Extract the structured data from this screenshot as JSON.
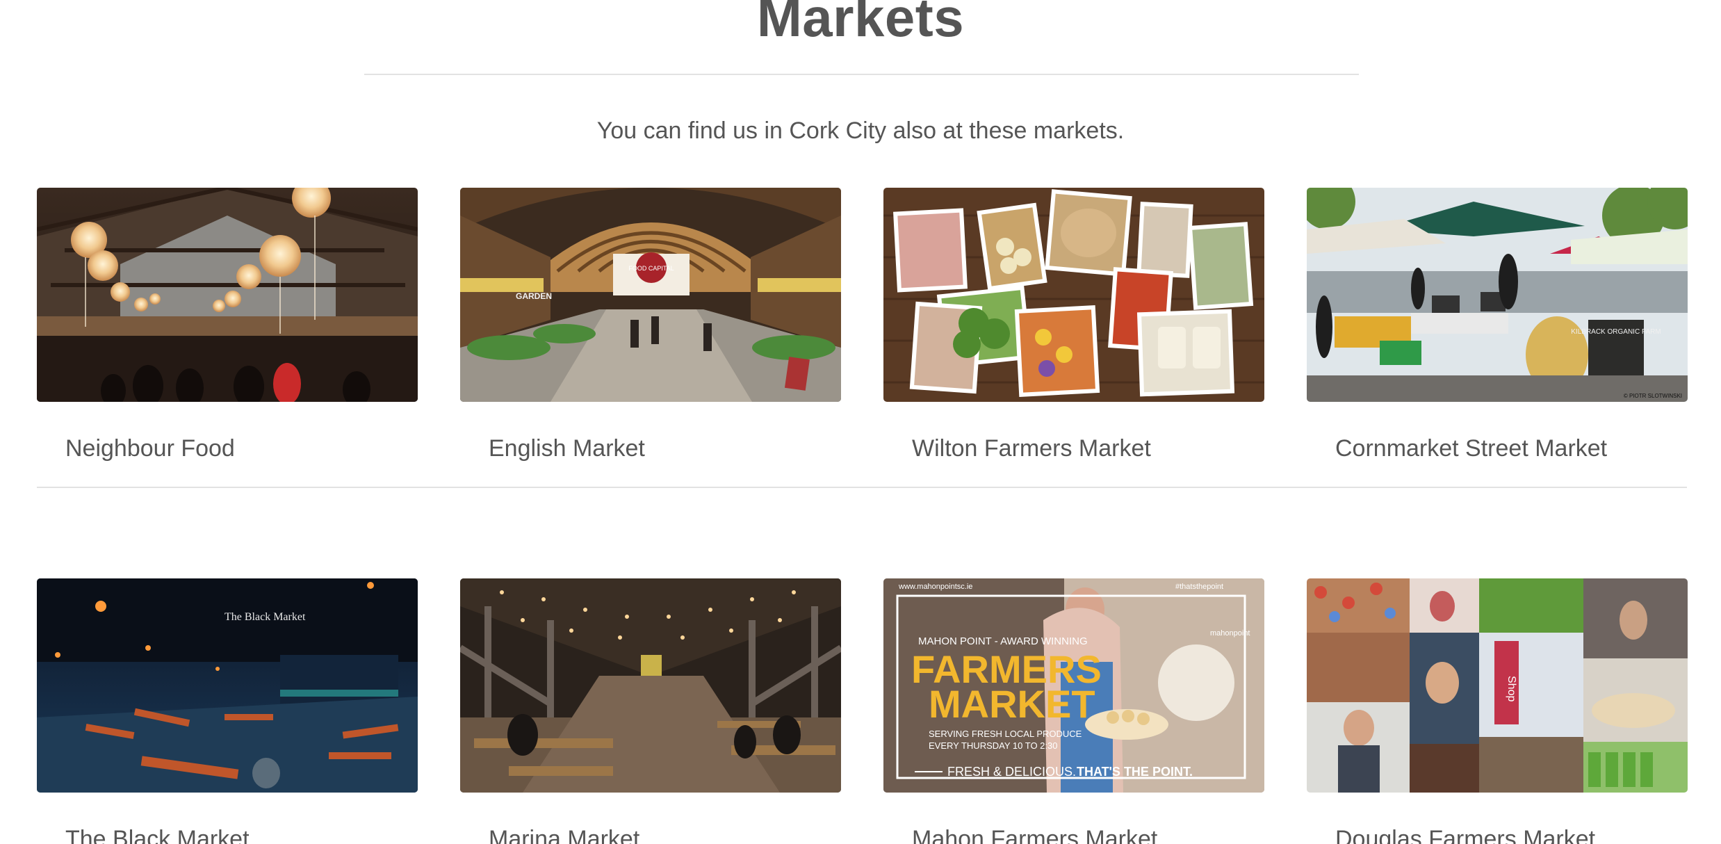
{
  "page": {
    "title": "Markets",
    "intro": "You can find us in Cork City also at these markets."
  },
  "markets": [
    {
      "name": "Neighbour Food",
      "image": "neighbour-food-hall-lanterns"
    },
    {
      "name": "English Market",
      "image": "english-market-hall"
    },
    {
      "name": "Wilton Farmers Market",
      "image": "wilton-produce-collage"
    },
    {
      "name": "Cornmarket Street Market",
      "image": "cornmarket-street-stalls"
    },
    {
      "name": "The Black Market",
      "image": "black-market-night-seating"
    },
    {
      "name": "Marina Market",
      "image": "marina-market-warehouse"
    },
    {
      "name": "Mahon Farmers Market",
      "image": "mahon-farmers-market-poster"
    },
    {
      "name": "Douglas Farmers Market",
      "image": "douglas-market-collage"
    }
  ],
  "image_text": {
    "english_market_sign": "FOOD CAPITAL",
    "english_market_stall": "GARDEN",
    "cornmarket_board": "KILBRACK ORGANIC FARM",
    "cornmarket_credit": "© PIOTR SLOTWINSKI",
    "black_market_sign": "The Black Market",
    "mahon_url": "www.mahonpointsc.ie",
    "mahon_handle": "#thatsthepoint",
    "mahon_badge": "mahonpoint",
    "mahon_tagline": "MAHON POINT - AWARD WINNING",
    "mahon_headline_1": "FARMERS",
    "mahon_headline_2": "MARKET",
    "mahon_sub_1": "SERVING FRESH LOCAL PRODUCE",
    "mahon_sub_2": "EVERY THURSDAY 10 TO 2:30",
    "mahon_footer_1": "FRESH & DELICIOUS.",
    "mahon_footer_2": "THAT'S THE POINT.",
    "douglas_sign": "Shop"
  }
}
